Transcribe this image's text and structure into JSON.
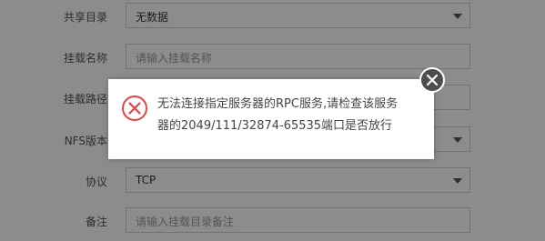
{
  "form": {
    "share_dir": {
      "label": "共享目录",
      "value": "无数据"
    },
    "mount_name": {
      "label": "挂载名称",
      "placeholder": "请输入挂载名称"
    },
    "mount_path": {
      "label": "挂载路径"
    },
    "nfs_version": {
      "label": "NFS版本"
    },
    "protocol": {
      "label": "协议",
      "value": "TCP"
    },
    "remark": {
      "label": "备注",
      "placeholder": "请输入挂载目录备注"
    }
  },
  "dialog": {
    "message_line1": "无法连接指定服务器的RPC服务,请检查该服务",
    "message_line2": "器的2049/111/32874-65535端口是否放行",
    "icon": "error-x-circle-icon",
    "close_icon": "close-icon",
    "error_color": "#e64545"
  }
}
